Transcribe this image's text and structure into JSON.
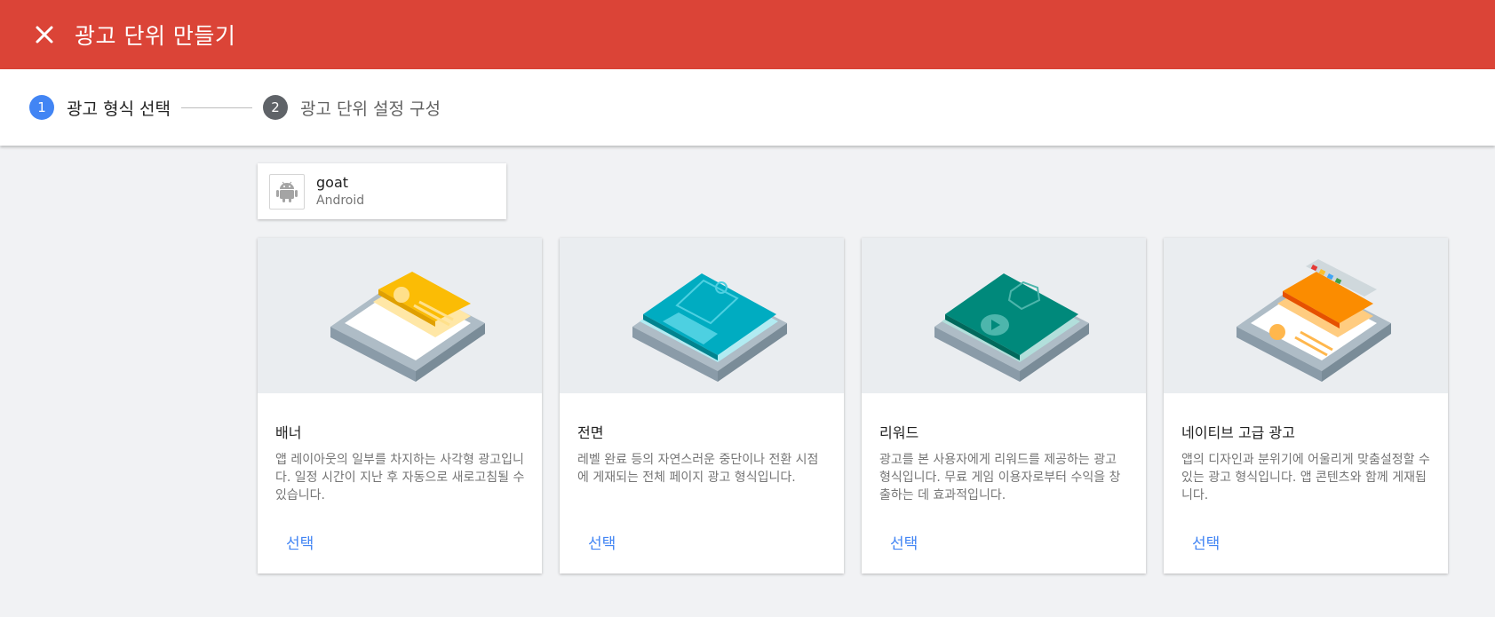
{
  "appbar": {
    "title": "광고 단위 만들기",
    "color": "#db4437"
  },
  "stepper": {
    "steps": [
      {
        "number": "1",
        "label": "광고 형식 선택",
        "state": "active"
      },
      {
        "number": "2",
        "label": "광고 단위 설정 구성",
        "state": "inactive"
      }
    ]
  },
  "app": {
    "name": "goat",
    "platform": "Android",
    "icon": "android-icon"
  },
  "cards": [
    {
      "title": "배너",
      "description": "앱 레이아웃의 일부를 차지하는 사각형 광고입니다. 일정 시간이 지난 후 자동으로 새로고침될 수 있습니다.",
      "select_label": "선택",
      "illustration": "banner-illustration"
    },
    {
      "title": "전면",
      "description": "레벨 완료 등의 자연스러운 중단이나 전환 시점에 게재되는 전체 페이지 광고 형식입니다.",
      "select_label": "선택",
      "illustration": "interstitial-illustration"
    },
    {
      "title": "리워드",
      "description": "광고를 본 사용자에게 리워드를 제공하는 광고 형식입니다. 무료 게임 이용자로부터 수익을 창출하는 데 효과적입니다.",
      "select_label": "선택",
      "illustration": "rewarded-illustration"
    },
    {
      "title": "네이티브 고급 광고",
      "description": "앱의 디자인과 분위기에 어울리게 맞춤설정할 수 있는 광고 형식입니다. 앱 콘텐츠와 함께 게재됩니다.",
      "select_label": "선택",
      "illustration": "native-illustration"
    }
  ],
  "colors": {
    "accent": "#4285f4",
    "header": "#db4437",
    "background": "#f1f2f4"
  }
}
